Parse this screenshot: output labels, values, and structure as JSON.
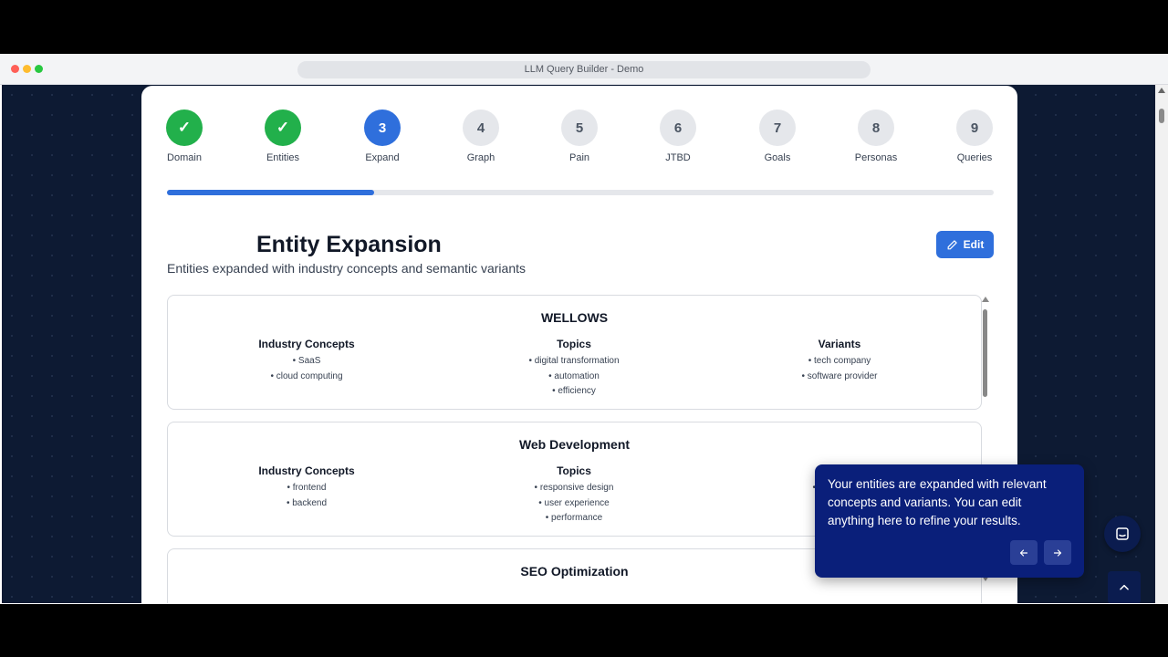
{
  "browser": {
    "title": "LLM Query Builder - Demo"
  },
  "steps": [
    {
      "label": "Domain",
      "marker": "✓",
      "state": "done"
    },
    {
      "label": "Entities",
      "marker": "✓",
      "state": "done"
    },
    {
      "label": "Expand",
      "marker": "3",
      "state": "active"
    },
    {
      "label": "Graph",
      "marker": "4",
      "state": "todo"
    },
    {
      "label": "Pain",
      "marker": "5",
      "state": "todo"
    },
    {
      "label": "JTBD",
      "marker": "6",
      "state": "todo"
    },
    {
      "label": "Goals",
      "marker": "7",
      "state": "todo"
    },
    {
      "label": "Personas",
      "marker": "8",
      "state": "todo"
    },
    {
      "label": "Queries",
      "marker": "9",
      "state": "todo"
    }
  ],
  "progress": {
    "fraction": 0.25
  },
  "header": {
    "title": "Entity Expansion",
    "subtitle": "Entities expanded with industry concepts and semantic variants",
    "edit_label": "Edit"
  },
  "entities": [
    {
      "name": "WELLOWS",
      "industry_heading": "Industry Concepts",
      "industry": [
        "• SaaS",
        "• cloud computing"
      ],
      "topics_heading": "Topics",
      "topics": [
        "• digital transformation",
        "• automation",
        "• efficiency"
      ],
      "variants_heading": "Variants",
      "variants": [
        "• tech company",
        "• software provider"
      ]
    },
    {
      "name": "Web Development",
      "industry_heading": "Industry Concepts",
      "industry": [
        "• frontend",
        "• backend"
      ],
      "topics_heading": "Topics",
      "topics": [
        "• responsive design",
        "• user experience",
        "• performance"
      ],
      "variants_heading": "",
      "variants": [
        "• w",
        "•"
      ]
    },
    {
      "name": "SEO Optimization",
      "industry_heading": "",
      "industry": [],
      "topics_heading": "",
      "topics": [],
      "variants_heading": "",
      "variants": []
    }
  ],
  "tooltip": {
    "text": "Your entities are expanded with relevant concepts and variants. You can edit anything here to refine your results.",
    "prev_icon": "arrow-left-icon",
    "next_icon": "arrow-right-icon"
  },
  "colors": {
    "done": "#22b04b",
    "active": "#2f6fdc",
    "tooltip_bg": "#0a1f7a"
  }
}
